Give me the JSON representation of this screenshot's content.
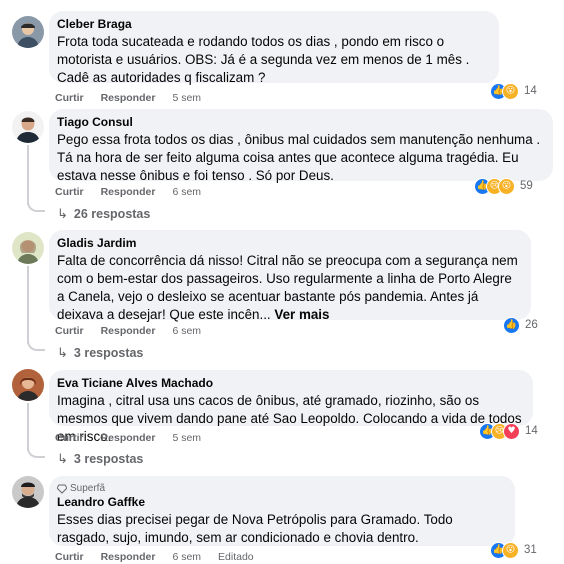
{
  "colors": {
    "bubble_bg": "#f0f2f5",
    "meta_text": "#65676b",
    "like_blue": "#1877f2",
    "love_red": "#f33e58",
    "wow_yellow": "#f7b125"
  },
  "action_labels": {
    "like": "Curtir",
    "reply": "Responder"
  },
  "comments": [
    {
      "author": "Cleber Braga",
      "text": "Frota toda sucateada e rodando todos os dias , pondo em risco o motorista e usuários. OBS: Já é a segunda vez em menos de 1 mês . Cadê as autoridades q fiscalizam ?",
      "time": "5 sem",
      "reactions": [
        "like-icon",
        "wow-icon"
      ],
      "reaction_count": "14"
    },
    {
      "author": "Tiago Consul",
      "text": "Pego essa frota todos os dias , ônibus mal cuidados sem manutenção nenhuma . Tá na hora de ser feito alguma coisa antes que acontece alguma tragédia. Eu estava nesse ônibus e foi tenso . Só por Deus.",
      "time": "6 sem",
      "reactions": [
        "like-icon",
        "sad-icon",
        "wow-icon"
      ],
      "reaction_count": "59",
      "replies": "26 respostas"
    },
    {
      "author": "Gladis Jardim",
      "text": "Falta de concorrência dá nisso! Citral não se preocupa com a segurança nem com o bem-estar dos passageiros. Uso regularmente a linha de Porto Alegre a Canela, vejo o desleixo se acentuar bastante pós pandemia. Antes já deixava a desejar! Que este incên...",
      "see_more": "Ver mais",
      "time": "6 sem",
      "reactions": [
        "like-icon"
      ],
      "reaction_count": "26",
      "replies": "3 respostas"
    },
    {
      "author": "Eva Ticiane Alves Machado",
      "text": "Imagina , citral usa uns cacos de ônibus, até gramado, riozinho, são os mesmos que vivem dando pane até Sao Leopoldo. Colocando a vida de todos em risco.",
      "time": "5 sem",
      "reactions": [
        "like-icon",
        "sad-icon",
        "love-icon"
      ],
      "reaction_count": "14",
      "replies": "3 respostas"
    },
    {
      "badge": "Superfã",
      "author": "Leandro Gaffke",
      "text": "Esses dias precisei pegar de Nova Petrópolis para Gramado. Todo rasgado, sujo, imundo, sem ar condicionado e chovia dentro.",
      "time": "6 sem",
      "edited": "Editado",
      "reactions": [
        "like-icon",
        "wow-icon"
      ],
      "reaction_count": "31"
    }
  ]
}
